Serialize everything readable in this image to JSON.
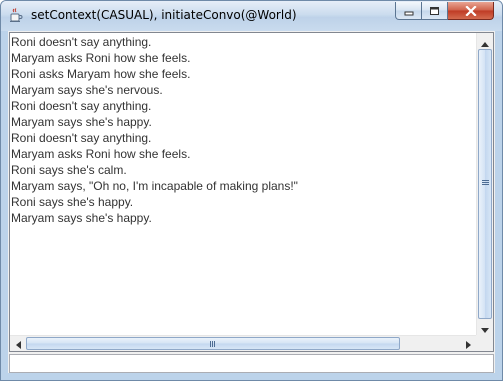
{
  "window": {
    "title": "setContext(CASUAL), initiateConvo(@World)",
    "icon": "java-cup-icon",
    "controls": {
      "minimize": "minimize-icon",
      "maximize": "maximize-icon",
      "close": "close-icon"
    }
  },
  "output": {
    "lines": [
      "Roni doesn't say anything.",
      "Maryam asks Roni how she feels.",
      "Roni asks Maryam how she feels.",
      "Maryam says she's nervous.",
      "Roni doesn't say anything.",
      "Maryam says she's happy.",
      "Roni doesn't say anything.",
      "Maryam asks Roni how she feels.",
      "Roni says she's calm.",
      "Maryam says, \"Oh no, I'm incapable of making plans!\"",
      "Roni says she's happy.",
      "Maryam says she's happy."
    ]
  },
  "input": {
    "value": "",
    "placeholder": ""
  },
  "colors": {
    "accent": "#bcd3ea",
    "close": "#c7432b",
    "text": "#333333"
  }
}
